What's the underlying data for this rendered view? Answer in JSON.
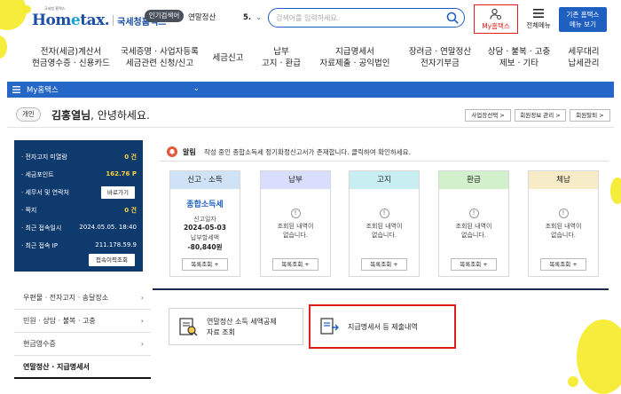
{
  "header": {
    "logo_subtitle": "국세청 홈택스",
    "logo_text_prefix": "Hom",
    "logo_text_e": "e",
    "logo_text_suffix": "tax.",
    "org_name": "국세청홈택스",
    "popular_label": "인기검색어",
    "popular_value": "연말정산",
    "popular_rank": "5.",
    "search_placeholder": "검색어를 입력하세요.",
    "mytax_label": "My홈택스",
    "allmenu_label": "전체메뉴",
    "basic_view_line1": "기존 홈택스",
    "basic_view_line2": "메뉴 보기"
  },
  "nav": [
    {
      "line1": "전자(세금)계산서",
      "line2": "현금영수증 · 신용카드"
    },
    {
      "line1": "국세증명 · 사업자등록",
      "line2": "세금관련 신청/신고"
    },
    {
      "line1": "세금신고",
      "line2": ""
    },
    {
      "line1": "납부",
      "line2": "고지 · 환급"
    },
    {
      "line1": "지급명세서",
      "line2": "자료제출 · 공익법인"
    },
    {
      "line1": "장려금 · 연말정산",
      "line2": "전자기부금"
    },
    {
      "line1": "상담 · 불복 · 고충",
      "line2": "제보 · 기타"
    },
    {
      "line1": "세무대리",
      "line2": "납세관리"
    }
  ],
  "strip": {
    "title": "My홈택스"
  },
  "greeting": {
    "grade": "개인",
    "name": "김홍열님",
    "suffix": ", 안녕하세요.",
    "buttons": [
      "사업장선택 >",
      "회원정보 관리 >",
      "회원탈퇴 >"
    ]
  },
  "info": {
    "rows": [
      {
        "label": "· 전자고지 미열람",
        "value": "0 건"
      },
      {
        "label": "· 세금포인트",
        "value": "162.76 P"
      },
      {
        "label": "· 세무서 및 연락처",
        "value": ""
      },
      {
        "label": "· 쪽지",
        "value": "0 건"
      },
      {
        "label": "· 최근 접속일시",
        "value": "2024.05.05. 18:40"
      },
      {
        "label": "· 최근 접속 IP",
        "value": "211.178.59.9"
      }
    ],
    "goto_label": "바로가기",
    "history_label": "접속이력조회"
  },
  "notice": {
    "label": "알림",
    "text": "작성 중인 종합소득세 정기확정신고서가 존재합니다. 클릭하여 확인하세요."
  },
  "cards": [
    {
      "title": "신고 · 소득",
      "color": "#cfe2f6",
      "main": "종합소득세",
      "date_label": "신고일자",
      "date": "2024-05-03",
      "amount_label": "납부할세액",
      "amount": "-80,840원",
      "button": "목록조회 +"
    },
    {
      "title": "납부",
      "color": "#d9defc",
      "msg1": "조회된 내역이",
      "msg2": "없습니다.",
      "button": "목록조회 +"
    },
    {
      "title": "고지",
      "color": "#c9eef2",
      "msg1": "조회된 내역이",
      "msg2": "없습니다.",
      "button": "목록조회 +"
    },
    {
      "title": "환급",
      "color": "#d3f0cd",
      "msg1": "조회된 내역이",
      "msg2": "없습니다.",
      "button": "목록조회 +"
    },
    {
      "title": "체납",
      "color": "#f7ecc8",
      "msg1": "조회된 내역이",
      "msg2": "없습니다.",
      "button": "목록조회 +"
    }
  ],
  "left_menu": [
    {
      "label": "우편물 · 전자고지 · 송달장소"
    },
    {
      "label": "민원 · 상담 · 불복 · 고충"
    },
    {
      "label": "현금영수증"
    },
    {
      "label": "연말정산 · 지급명세서"
    }
  ],
  "tiles": [
    {
      "line1": "연말정산 소득 세액공제",
      "line2": "자료 조회"
    },
    {
      "line1": "지급명세서 등 제출내역",
      "line2": ""
    }
  ],
  "colors": {
    "brand_blue": "#1f5fbf",
    "navy_panel": "#0e3a6d",
    "highlight_red": "#e01e1e",
    "splash_yellow": "#f4ea2a"
  }
}
